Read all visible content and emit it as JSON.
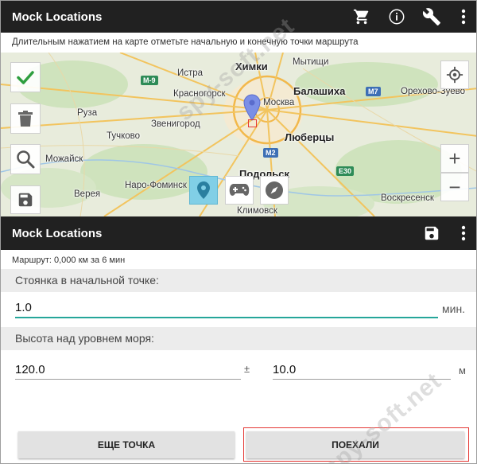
{
  "top_bar": {
    "title": "Mock Locations",
    "actions": [
      "cart-icon",
      "info-icon",
      "wrench-icon",
      "more-vert-icon"
    ]
  },
  "map": {
    "hint": "Длительным нажатием на карте отметьте начальную и конечную точки маршрута",
    "places": [
      {
        "id": "khimki",
        "label": "Химки",
        "big": true
      },
      {
        "id": "mytishchi",
        "label": "Мытищи",
        "big": false
      },
      {
        "id": "istra",
        "label": "Истра",
        "big": false
      },
      {
        "id": "balashikha",
        "label": "Балашиха",
        "big": true
      },
      {
        "id": "krasnogorsk",
        "label": "Красногорск",
        "big": false
      },
      {
        "id": "moskva",
        "label": "Москва",
        "big": false
      },
      {
        "id": "orekhovo",
        "label": "Орехово-Зуево",
        "big": false
      },
      {
        "id": "ruza",
        "label": "Руза",
        "big": false
      },
      {
        "id": "zvenigorod",
        "label": "Звенигород",
        "big": false
      },
      {
        "id": "lyubertsy",
        "label": "Люберцы",
        "big": true
      },
      {
        "id": "tuchkovo",
        "label": "Тучково",
        "big": false
      },
      {
        "id": "mozhaysk",
        "label": "Можайск",
        "big": false
      },
      {
        "id": "naro",
        "label": "Наро-Фоминск",
        "big": false
      },
      {
        "id": "podolsk",
        "label": "Подольск",
        "big": true
      },
      {
        "id": "vereya",
        "label": "Верея",
        "big": false
      },
      {
        "id": "voskresensk",
        "label": "Воскресенск",
        "big": false
      },
      {
        "id": "klimovsk",
        "label": "Климовск",
        "big": false
      }
    ],
    "shields": [
      {
        "id": "m9",
        "label": "M-9",
        "color": "green"
      },
      {
        "id": "m7",
        "label": "M7",
        "color": "blue"
      },
      {
        "id": "m2",
        "label": "M2",
        "color": "blue"
      },
      {
        "id": "e30",
        "label": "E30",
        "color": "green"
      }
    ],
    "left_tools": [
      "check-icon",
      "trash-icon",
      "search-icon",
      "save-icon"
    ],
    "modes": [
      {
        "icon": "map-pin-icon",
        "selected": true
      },
      {
        "icon": "gamepad-icon",
        "selected": false
      },
      {
        "icon": "compass-icon",
        "selected": false
      }
    ],
    "zoom_in": "+",
    "zoom_out": "−"
  },
  "second_bar": {
    "title": "Mock Locations",
    "actions": [
      "save-icon",
      "more-vert-icon"
    ]
  },
  "route_info": "Маршрут: 0,000 км за 6 мин",
  "stay": {
    "label": "Стоянка в начальной точке:",
    "value": "1.0",
    "unit": "мин."
  },
  "altitude": {
    "label": "Высота над уровнем моря:",
    "value": "120.0",
    "plusminus": "±",
    "accuracy": "10.0",
    "unit": "м"
  },
  "buttons": {
    "more_point": "ЕЩЕ ТОЧКА",
    "go": "ПОЕХАЛИ"
  },
  "watermark": "spy-soft.net",
  "colors": {
    "appbar": "#212121",
    "accent": "#26a69a",
    "check": "#2e9e3e",
    "highlight": "#e53935"
  }
}
